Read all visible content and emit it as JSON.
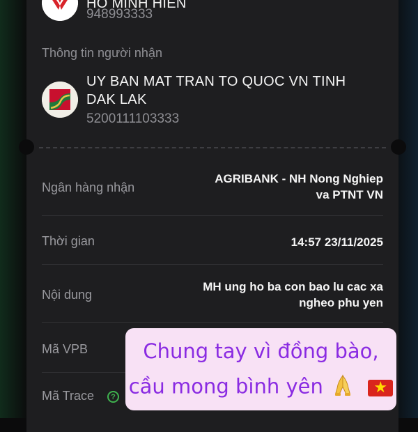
{
  "sender": {
    "name": "HO MINH HIEN",
    "account": "948993333"
  },
  "receiver": {
    "section_label": "Thông tin người nhận",
    "name": "UY BAN MAT TRAN TO QUOC VN TINH DAK LAK",
    "account": "5200111103333"
  },
  "details": {
    "bank": {
      "label": "Ngân hàng nhận",
      "value_line1": "AGRIBANK - NH Nong Nghiep",
      "value_line2": "va PTNT VN"
    },
    "time": {
      "label": "Thời gian",
      "value": "14:57 23/11/2025"
    },
    "content": {
      "label": "Nội dung",
      "value_line1": "MH ung ho ba con bao lu cac xa",
      "value_line2": "ngheo phu yen"
    },
    "vpb_code": {
      "label": "Mã VPB"
    },
    "trace_code": {
      "label": "Mã Trace",
      "help_icon": "help-circle-icon"
    }
  },
  "overlay": {
    "line1": "Chung tay vì đồng bào,",
    "line2": "cầu mong bình yên",
    "icons": [
      "folded-hands-icon",
      "vietnam-flag-icon"
    ],
    "text_color": "#8a2be2",
    "background_color": "#f8e1f5"
  },
  "colors": {
    "card_bg": "#1e1e20",
    "page_bg": "#0b0b0c",
    "sender_logo_red": "#d8232a",
    "receiver_logo_red": "#c8102e",
    "receiver_logo_green": "#1f7a3a",
    "help_icon_green": "#3fb34f"
  }
}
